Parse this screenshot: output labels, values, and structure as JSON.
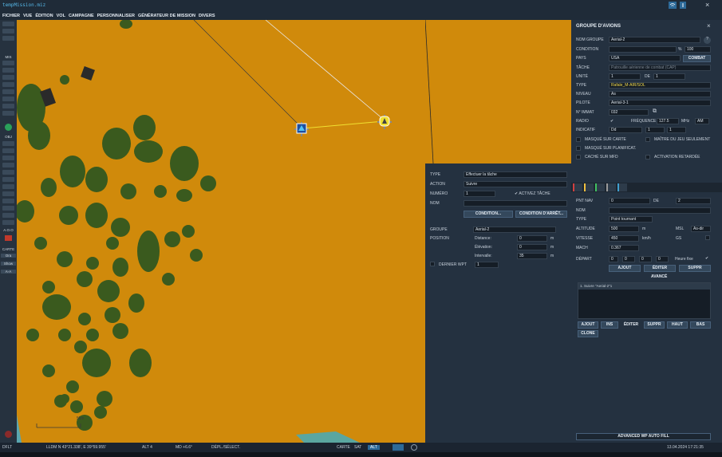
{
  "window": {
    "title": "tempMission.miz"
  },
  "menu": [
    "FICHIER",
    "VUE",
    "ÉDITION",
    "VOL",
    "CAMPAGNE",
    "PERSONNALISER",
    "GÉNÉRATEUR DE MISSION",
    "DIVERS"
  ],
  "left_toolbar": {
    "mis": "MIS",
    "obj": "OBJ",
    "carte": "CARTE",
    "btn1": "Ora",
    "btn2": "Show",
    "btn3": "A-A",
    "aoo": "A.O.O"
  },
  "map": {
    "unit_marker_1": "▲",
    "unit_marker_2": "▲",
    "scale_label": "5km"
  },
  "group": {
    "title": "GROUPE D'AVIONS",
    "nom_groupe_label": "NOM GROUPE",
    "nom_groupe": "Aerial-2",
    "help": "?",
    "condition_label": "CONDITION",
    "condition_pct": "%",
    "condition_val": "100",
    "pays_label": "PAYS",
    "pays": "USA",
    "combat_btn": "COMBAT",
    "tache_label": "TÂCHE",
    "tache": "Patrouille aérienne de combat (CAP)",
    "unite_label": "UNITÉ",
    "unite_val": "1",
    "de_label": "DE",
    "de_val": "1",
    "type_label": "TYPE",
    "type": "Rafale_M-AIR/SOL",
    "niveau_label": "NIVEAU",
    "niveau": "As",
    "pilote_label": "PILOTE",
    "pilote": "Aerial-3-1",
    "nimmat_label": "N° IMMAT",
    "nimmat": "032",
    "radio_label": "RADIO",
    "radio_check": "✔",
    "frequence_label": "FRÉQUENCE",
    "frequence": "127.5",
    "mhz": "MHz",
    "am": "AM",
    "indicatif_label": "INDICATIF",
    "indicatif": "Dd",
    "ind1": "1",
    "ind2": "1",
    "cb_masque_carte": "MASQUÉ SUR CARTE",
    "cb_maitre_jeu": "MAÎTRE DU JEU SEULEMENT",
    "cb_masque_planif": "MASQUÉ SUR PLANIFICAT.",
    "cb_cache_mfd": "CACHÉ SUR MFD",
    "cb_activation": "ACTIVATION RETARDÉE"
  },
  "waypoint": {
    "pnt_nav_label": "PNT NAV",
    "pnt_nav": "0",
    "de_label": "DE",
    "de_val": "2",
    "nom_label": "NOM",
    "nom": "",
    "type_label": "TYPE",
    "type": "Point tournant",
    "altitude_label": "ALTITUDE",
    "altitude": "500",
    "alt_unit": "m",
    "msl": "MSL",
    "alt_mode": "As-dir",
    "vitesse_label": "VITESSE",
    "vitesse": "450",
    "vit_unit": "km/h",
    "gs": "GS",
    "mach_label": "MACH",
    "mach": "0.367",
    "depart_label": "DÉPART",
    "d1": "0",
    "d2": "0",
    "d3": "0",
    "d4": "0",
    "heure_fixe": "Heure fixe",
    "ajout_btn": "AJOUT",
    "editer_btn": "ÉDITER",
    "suppr_btn": "SUPPR",
    "avance": "AVANCÉ",
    "actions_list": [
      "1. Suivre \"Aerial-2\"1"
    ],
    "act_ajout": "AJOUT",
    "act_ins": "INS",
    "act_editer": "ÉDITER",
    "act_suppr": "SUPPR",
    "act_haut": "HAUT",
    "act_bas": "BAS",
    "act_clone": "CLONE",
    "advanced_btn": "ADVANCED WP AUTO FILL"
  },
  "task": {
    "type_label": "TYPE",
    "type": "Effectuer la tâche",
    "action_label": "ACTION",
    "action": "Suivre",
    "numero_label": "NUMÉRO",
    "numero": "1",
    "active_tache": "ACTIVEZ TÂCHE",
    "nom_label": "NOM",
    "nom": "",
    "condition_btn": "CONDITION...",
    "condition_arret_btn": "CONDITION D'ARRÊT...",
    "groupe_label": "GROUPE",
    "groupe": "Aerial-2",
    "position_label": "POSITION",
    "distance_label": "Distance:",
    "distance": "0",
    "dist_unit": "m",
    "elevation_label": "Élévation:",
    "elevation": "0",
    "elev_unit": "m",
    "intervalle_label": "Intervalle:",
    "intervalle": "35",
    "int_unit": "m",
    "dernier_wpt": "DERNIER WPT",
    "dernier_val": "1"
  },
  "status": {
    "mode": "DFLT",
    "coords": "LLDM   N 43°21.338', E 39°59.955'",
    "alt": "ALT   4",
    "md": "MD   +6.6°",
    "depl": "DÉPL./SÉLECT.",
    "carte": "CARTE",
    "sat": "SAT",
    "alt_btn": "ALT",
    "datetime": "13.04.2024  17:21:35"
  }
}
